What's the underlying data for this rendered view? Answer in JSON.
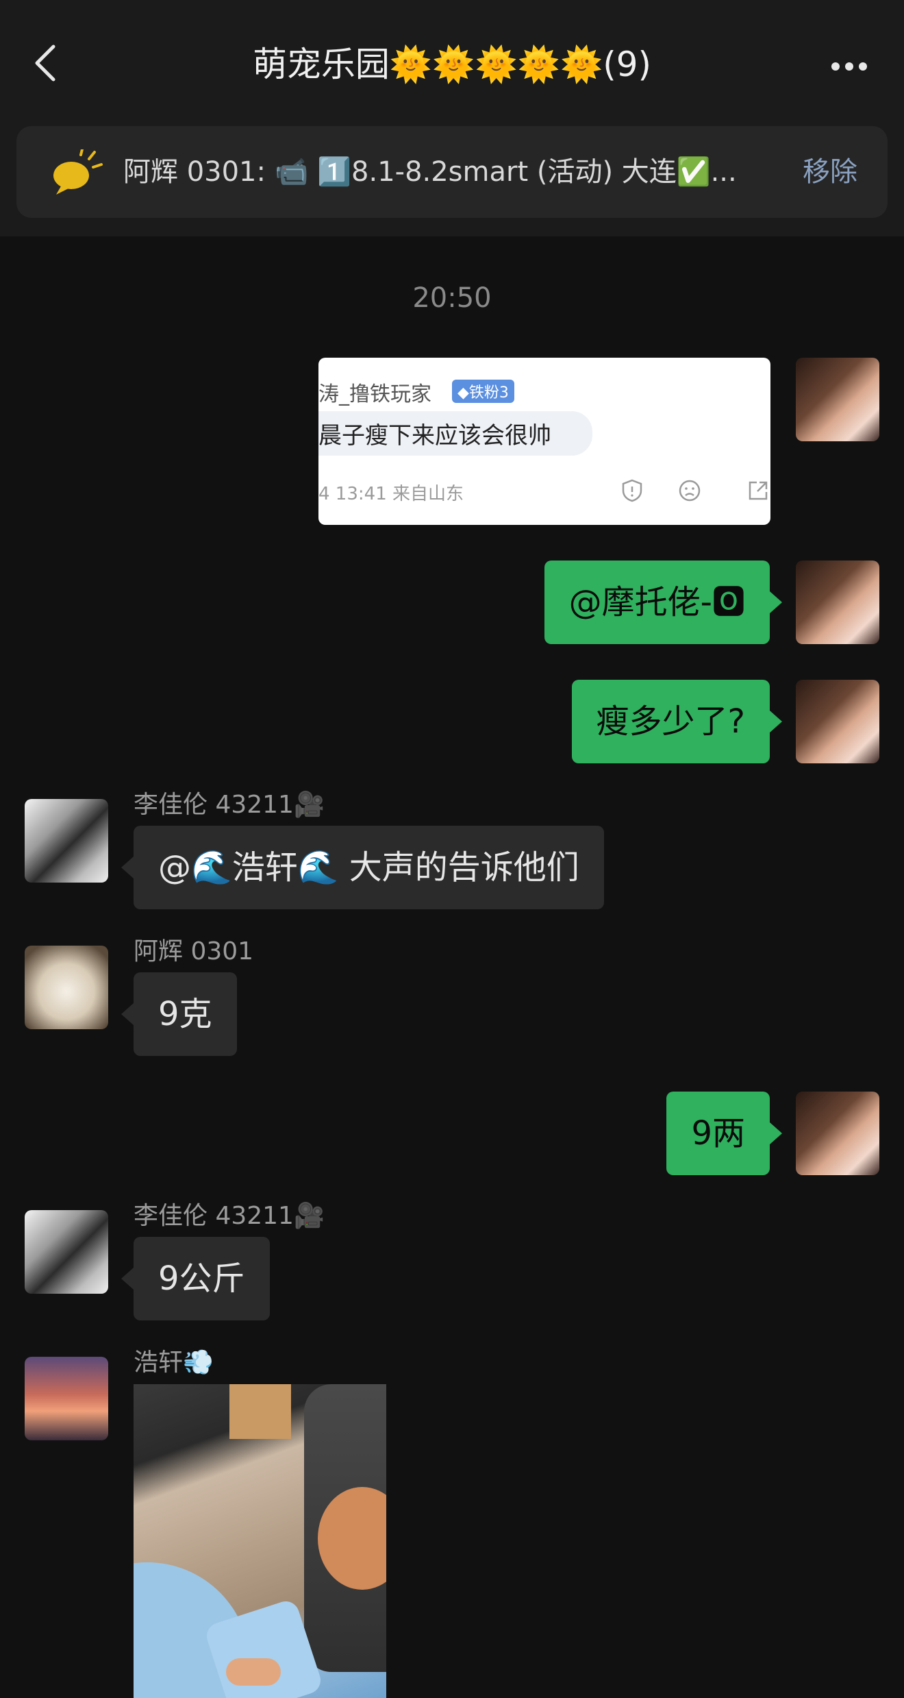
{
  "header": {
    "title": "萌宠乐园🌞🌞🌞🌞🌞(9)"
  },
  "pinned": {
    "text": "阿辉 0301: 📹 1️⃣8.1-8.2smart (活动) 大连✅...",
    "remove_label": "移除"
  },
  "timestamp": "20:50",
  "card": {
    "user": "涛_撸铁玩家",
    "badge": "◆铁粉3",
    "text": "晨子瘦下来应该会很帅",
    "meta": "4 13:41 来自山东"
  },
  "messages": {
    "m1": "@摩托佬-🅾",
    "m2": "瘦多少了?",
    "m3_sender": "李佳伦 43211🎥",
    "m3": "@🌊浩轩🌊 大声的告诉他们",
    "m4_sender": "阿辉 0301",
    "m4": "9克",
    "m5": "9两",
    "m6_sender": "李佳伦 43211🎥",
    "m6": "9公斤",
    "m7_sender": "浩轩💨"
  },
  "icons": {
    "back": "chevron-left-icon",
    "more": "more-icon",
    "pinned": "announcement-icon"
  },
  "colors": {
    "bubble_out": "#2fb15e",
    "bubble_in": "#2b2b2b",
    "background": "#111111",
    "remove": "#8aa1c1"
  }
}
